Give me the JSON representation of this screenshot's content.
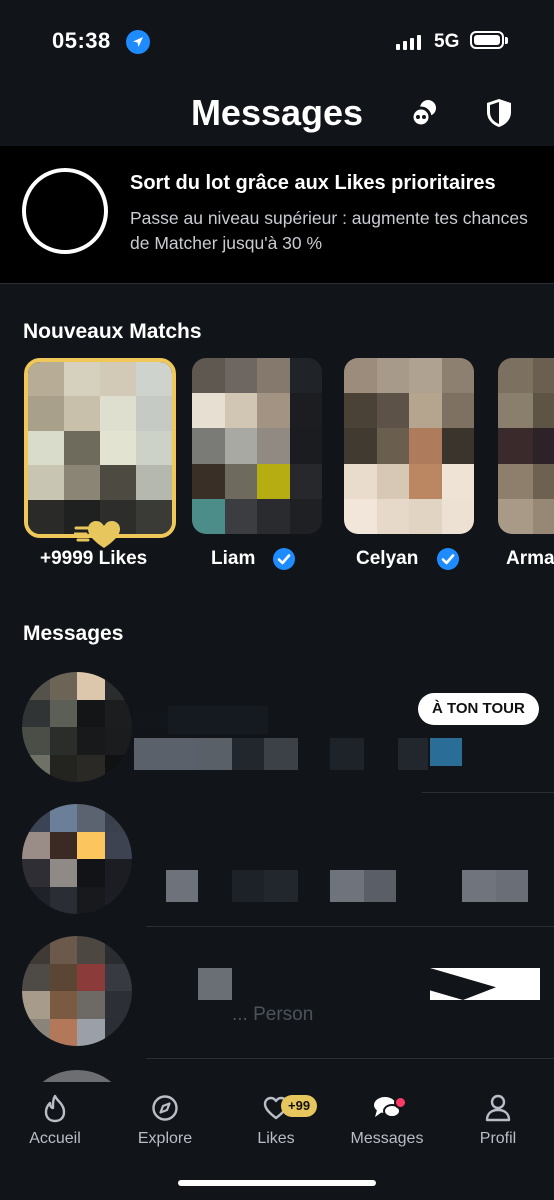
{
  "status_bar": {
    "time": "05:38",
    "network": "5G"
  },
  "header": {
    "title": "Messages",
    "icons": [
      "discover-toggle-icon",
      "safety-shield-icon"
    ]
  },
  "promo": {
    "title": "Sort du lot grâce aux Likes prioritaires",
    "description": "Passe au niveau supérieur : augmente tes chances de Matcher jusqu'à 30 %"
  },
  "new_matches": {
    "title": "Nouveaux Matchs",
    "likes_label": "+9999 Likes",
    "items": [
      {
        "name": "Liam",
        "verified": true
      },
      {
        "name": "Celyan",
        "verified": true
      },
      {
        "name": "Arma",
        "verified": false
      }
    ]
  },
  "messages": {
    "title": "Messages",
    "rows": [
      {
        "tag": "À TON TOUR"
      },
      {
        "tag": ""
      },
      {
        "tag": "",
        "preview_fragment": "... Person"
      }
    ]
  },
  "tabbar": {
    "items": [
      {
        "label": "Accueil",
        "icon": "flame-icon",
        "active": false
      },
      {
        "label": "Explore",
        "icon": "compass-icon",
        "active": false
      },
      {
        "label": "Likes",
        "icon": "heart-icon",
        "active": false,
        "badge": "+99"
      },
      {
        "label": "Messages",
        "icon": "chat-bubbles-icon",
        "active": true
      },
      {
        "label": "Profil",
        "icon": "person-icon",
        "active": false
      }
    ]
  },
  "colors": {
    "background": "#111418",
    "gold": "#e7c65d",
    "verified_blue": "#1e8cff",
    "notification": "#ff3a67"
  }
}
